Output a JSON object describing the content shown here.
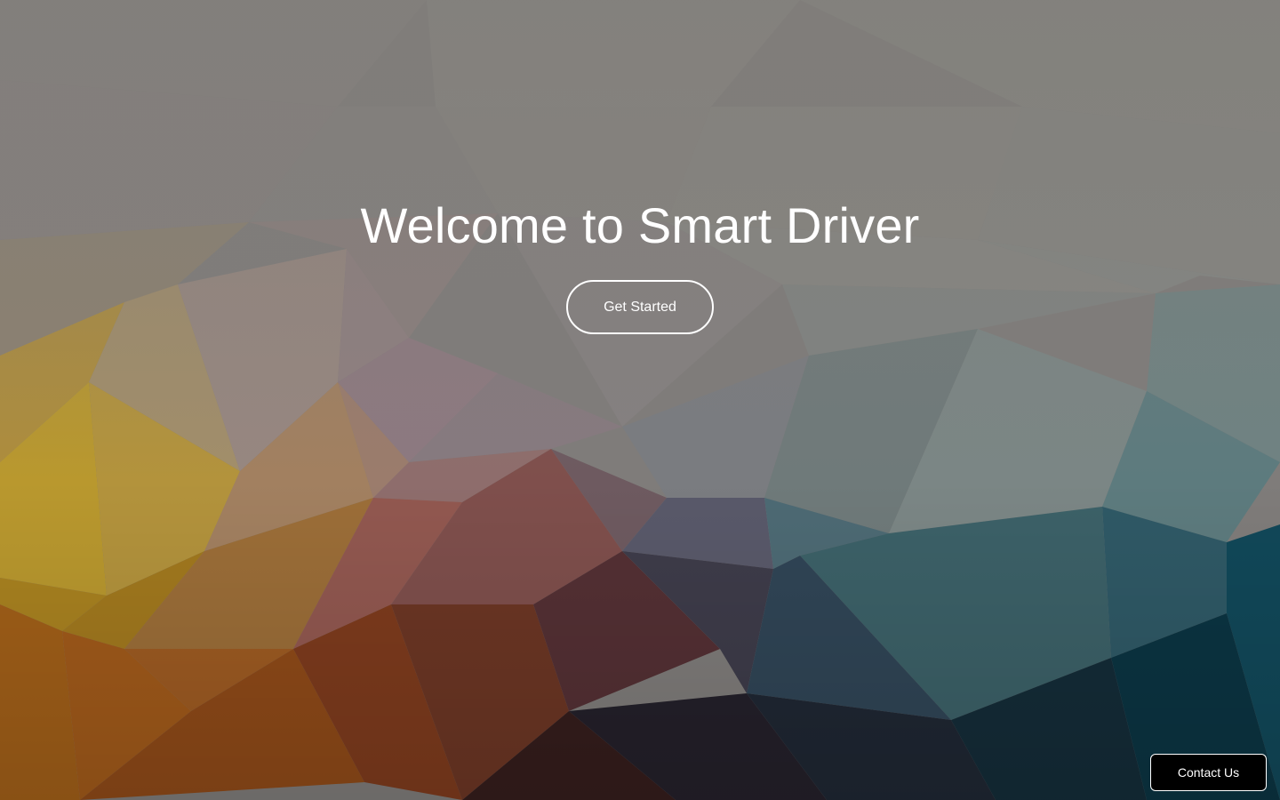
{
  "hero": {
    "title": "Welcome to Smart Driver",
    "cta_label": "Get Started"
  },
  "contact": {
    "label": "Contact Us"
  },
  "colors": {
    "text": "#ffffff",
    "contact_bg": "#000000",
    "background_top": "#86827e",
    "background_left": "#c09a3a",
    "background_bottom_left": "#8a4418",
    "background_bottom_right": "#0d3a48"
  }
}
